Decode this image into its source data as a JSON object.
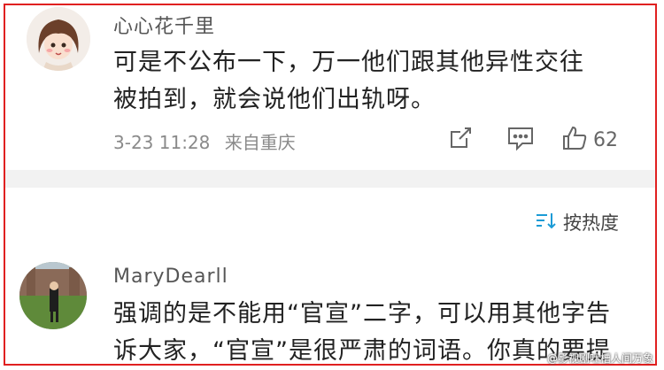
{
  "comments": [
    {
      "username": "心心花千里",
      "lines": [
        "可是不公布一下，万一他们跟其他异性交往",
        "被拍到，就会说他们出轨呀。"
      ],
      "date": "3-23 11:28",
      "location": "来自重庆",
      "likes": "62"
    },
    {
      "username": "MaryDearll",
      "lines": [
        "强调的是不能用“官宣”二字，可以用其他字告",
        "诉大家，“官宣”是很严肃的词语。你真的要提"
      ]
    }
  ],
  "sort_label": "按热度",
  "watermark": "@影视剧吐槽人间万象",
  "icons": {
    "share": "share-icon",
    "comment": "comment-icon",
    "like": "thumbs-up-icon",
    "sort": "sort-icon"
  },
  "colors": {
    "highlight_border": "#e02020",
    "divider": "#f2f2f2",
    "meta_text": "#8a8a8a"
  }
}
